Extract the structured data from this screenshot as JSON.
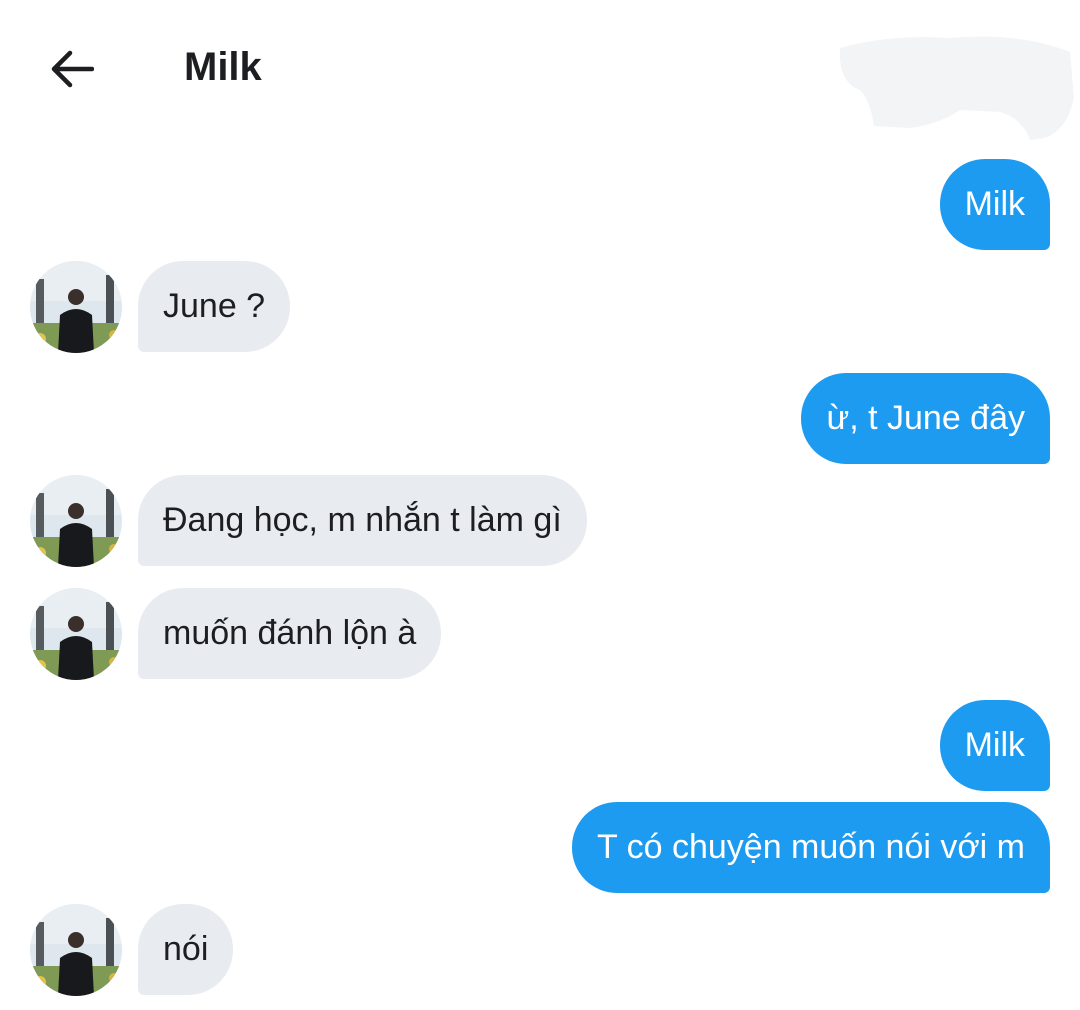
{
  "header": {
    "title": "Milk",
    "back_icon": "arrow-left-icon"
  },
  "messages": [
    {
      "from": "me",
      "text": "Milk"
    },
    {
      "from": "them",
      "text": "June ?"
    },
    {
      "from": "me",
      "text": "ừ, t June đây"
    },
    {
      "from": "them",
      "text": "Đang học, m nhắn t làm gì"
    },
    {
      "from": "them",
      "text": "muốn đánh lộn à"
    },
    {
      "from": "me",
      "text": "Milk"
    },
    {
      "from": "me",
      "text": "T có chuyện muốn nói với m"
    },
    {
      "from": "them",
      "text": "nói"
    }
  ],
  "colors": {
    "outgoing_bubble": "#1d9bf0",
    "incoming_bubble": "#e8ecf0",
    "background": "#ffffff"
  }
}
